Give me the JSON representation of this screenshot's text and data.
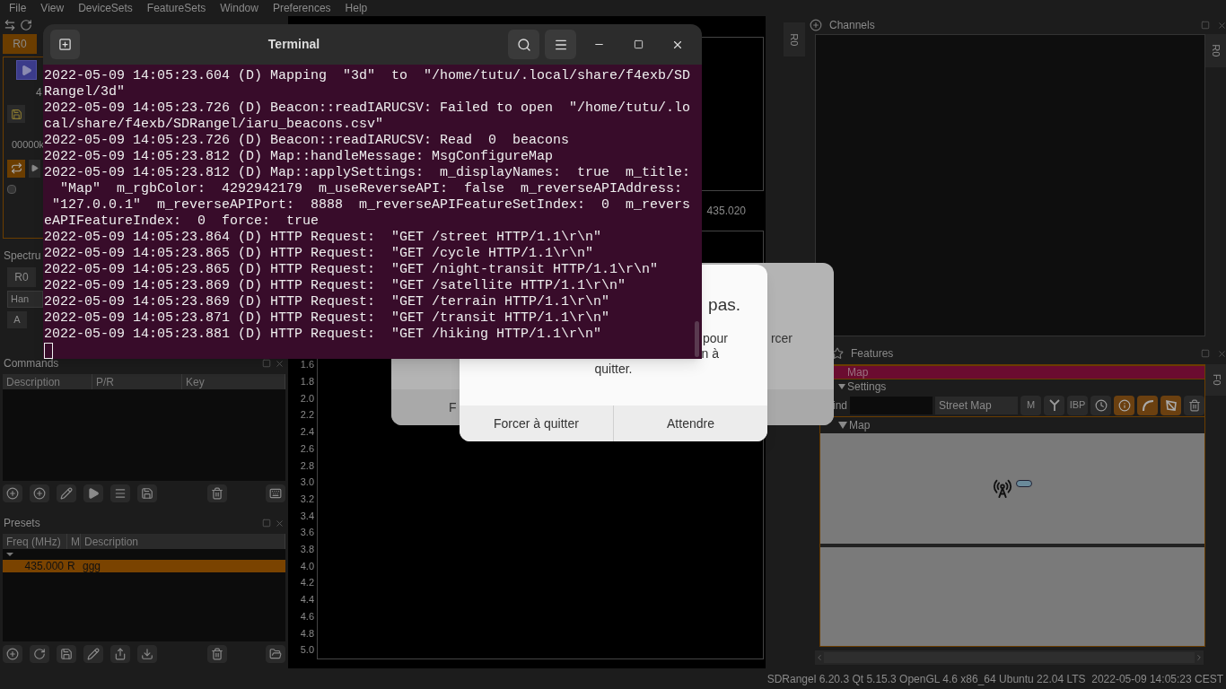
{
  "menu_bar": [
    "File",
    "View",
    "DeviceSets",
    "FeatureSets",
    "Window",
    "Preferences",
    "Help"
  ],
  "device_panel": {
    "tab": "R0",
    "frequency_digits": "4",
    "rate": "00000k"
  },
  "spectrum_panel": {
    "title": "Spectru",
    "tab": "R0",
    "window_function": "Han",
    "auto_button": "A"
  },
  "commands": {
    "title": "Commands",
    "columns": [
      "Description",
      "P/R",
      "Key"
    ]
  },
  "presets": {
    "title": "Presets",
    "columns": [
      "Freq (MHz)",
      "M",
      "Description"
    ],
    "rows": [
      {
        "freq": "435.000",
        "mode": "R",
        "description": "ggg",
        "selected": true
      }
    ]
  },
  "spectrum": {
    "frequency_label": "435.020",
    "y_labels": [
      "1.6",
      "1.8",
      "2.0",
      "2.2",
      "2.4",
      "2.6",
      "2.8",
      "3.0",
      "3.2",
      "3.4",
      "3.6",
      "3.8",
      "4.0",
      "4.2",
      "4.4",
      "4.6",
      "4.8",
      "5.0"
    ],
    "side_tab": "R0"
  },
  "channels": {
    "title": "Channels",
    "side_tab": "R0"
  },
  "features": {
    "title": "Features",
    "side_tab": "F0",
    "feature": {
      "title": "Map",
      "settings_label": "Settings",
      "find_label": "ind",
      "map_style": "Street Map",
      "map_section": "Map",
      "buttons": [
        {
          "label": "M",
          "on": false
        },
        {
          "on": false
        },
        {
          "label": "IBP",
          "on": false
        },
        {
          "on": false
        },
        {
          "on": true
        },
        {
          "on": true
        },
        {
          "on": true
        },
        {
          "on": false
        }
      ]
    }
  },
  "status_bar": "SDRangel 6.20.3 Qt 5.15.3 OpenGL 4.6 x86_64 Ubuntu 22.04 LTS  2022-05-09 14:05:23 CEST",
  "back_dialog": {
    "text_fragment": "rcer",
    "button_fragment": "F"
  },
  "dialog": {
    "title_fragment": "pas.",
    "body_fragments": [
      "pour",
      "n à",
      "quitter."
    ],
    "buttons": [
      "Forcer à quitter",
      "Attendre"
    ]
  },
  "terminal": {
    "title": "Terminal",
    "lines": [
      "2022-05-09 14:05:23.604 (D) Mapping  \"3d\"  to  \"/home/tutu/.local/share/f4exb/SD",
      "Rangel/3d\"",
      "2022-05-09 14:05:23.726 (D) Beacon::readIARUCSV: Failed to open  \"/home/tutu/.lo",
      "cal/share/f4exb/SDRangel/iaru_beacons.csv\"",
      "2022-05-09 14:05:23.726 (D) Beacon::readIARUCSV: Read  0  beacons",
      "2022-05-09 14:05:23.812 (D) Map::handleMessage: MsgConfigureMap",
      "2022-05-09 14:05:23.812 (D) Map::applySettings:  m_displayNames:  true  m_title:",
      "  \"Map\"  m_rgbColor:  4292942179  m_useReverseAPI:  false  m_reverseAPIAddress:",
      " \"127.0.0.1\"  m_reverseAPIPort:  8888  m_reverseAPIFeatureSetIndex:  0  m_revers",
      "eAPIFeatureIndex:  0  force:  true",
      "2022-05-09 14:05:23.864 (D) HTTP Request:  \"GET /street HTTP/1.1\\r\\n\"",
      "2022-05-09 14:05:23.865 (D) HTTP Request:  \"GET /cycle HTTP/1.1\\r\\n\"",
      "2022-05-09 14:05:23.865 (D) HTTP Request:  \"GET /night-transit HTTP/1.1\\r\\n\"",
      "2022-05-09 14:05:23.869 (D) HTTP Request:  \"GET /satellite HTTP/1.1\\r\\n\"",
      "2022-05-09 14:05:23.869 (D) HTTP Request:  \"GET /terrain HTTP/1.1\\r\\n\"",
      "2022-05-09 14:05:23.871 (D) HTTP Request:  \"GET /transit HTTP/1.1\\r\\n\"",
      "2022-05-09 14:05:23.881 (D) HTTP Request:  \"GET /hiking HTTP/1.1\\r\\n\""
    ]
  }
}
